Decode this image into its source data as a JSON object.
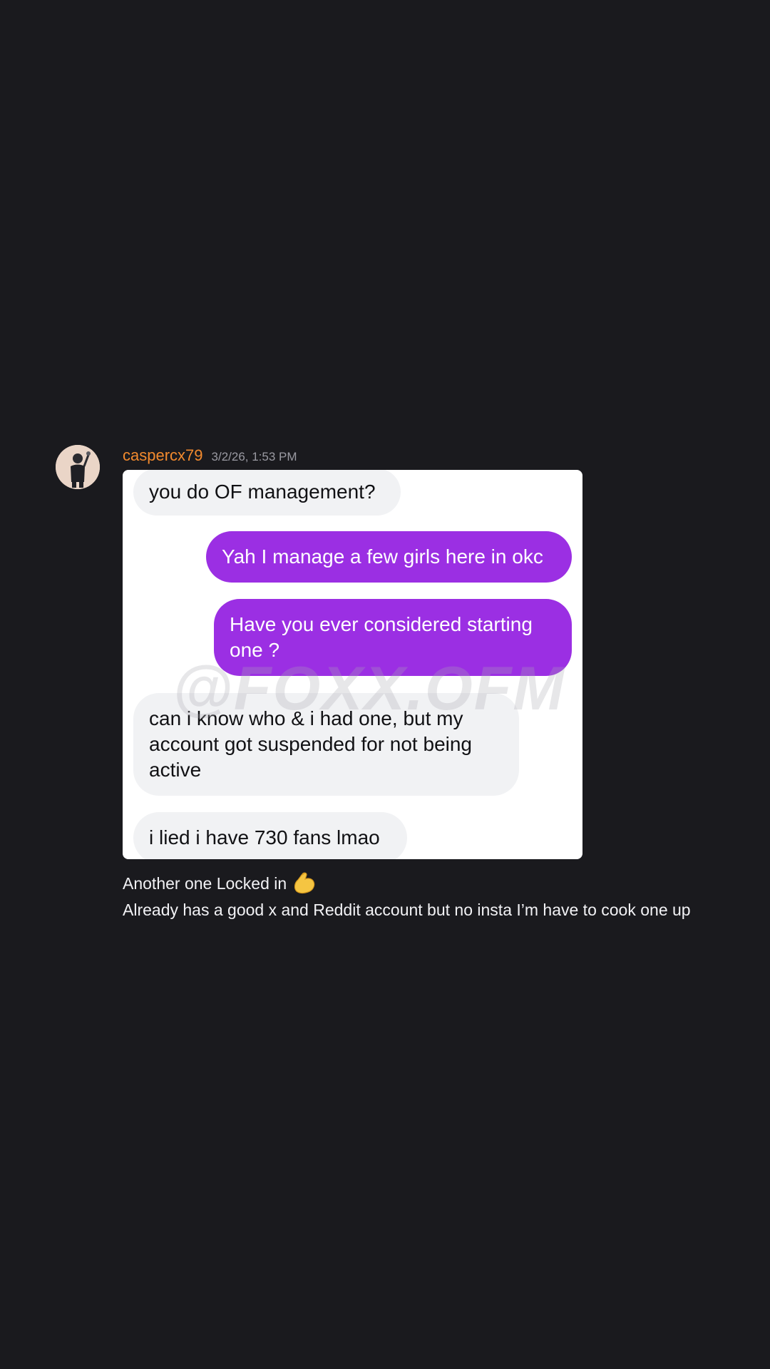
{
  "message": {
    "username": "caspercx79",
    "timestamp": "3/2/26, 1:53 PM",
    "avatar_icon": "user-avatar-icon",
    "embedded_screenshot": {
      "watermark": "@FOXX.OFM",
      "bubbles": [
        {
          "side": "incoming",
          "text": "you do OF management?"
        },
        {
          "side": "outgoing",
          "text": "Yah I manage a few girls here in okc"
        },
        {
          "side": "outgoing",
          "text": "Have you ever considered starting one ?"
        },
        {
          "side": "incoming",
          "text": "can i know who & i had one, but my account got suspended for not being active"
        },
        {
          "side": "incoming",
          "text": "i lied i have 730 fans lmao"
        }
      ],
      "colors": {
        "incoming_bubble": "#f1f2f4",
        "outgoing_bubble": "#9b2fe3"
      }
    },
    "lines": [
      "Another one Locked in",
      "Already has a good x and Reddit account but no insta I’m have to cook one up"
    ],
    "line1_emoji": "flexed-biceps-icon"
  },
  "colors": {
    "background": "#1a1a1e",
    "username": "#f28a2e",
    "text": "#f2f2f5"
  }
}
